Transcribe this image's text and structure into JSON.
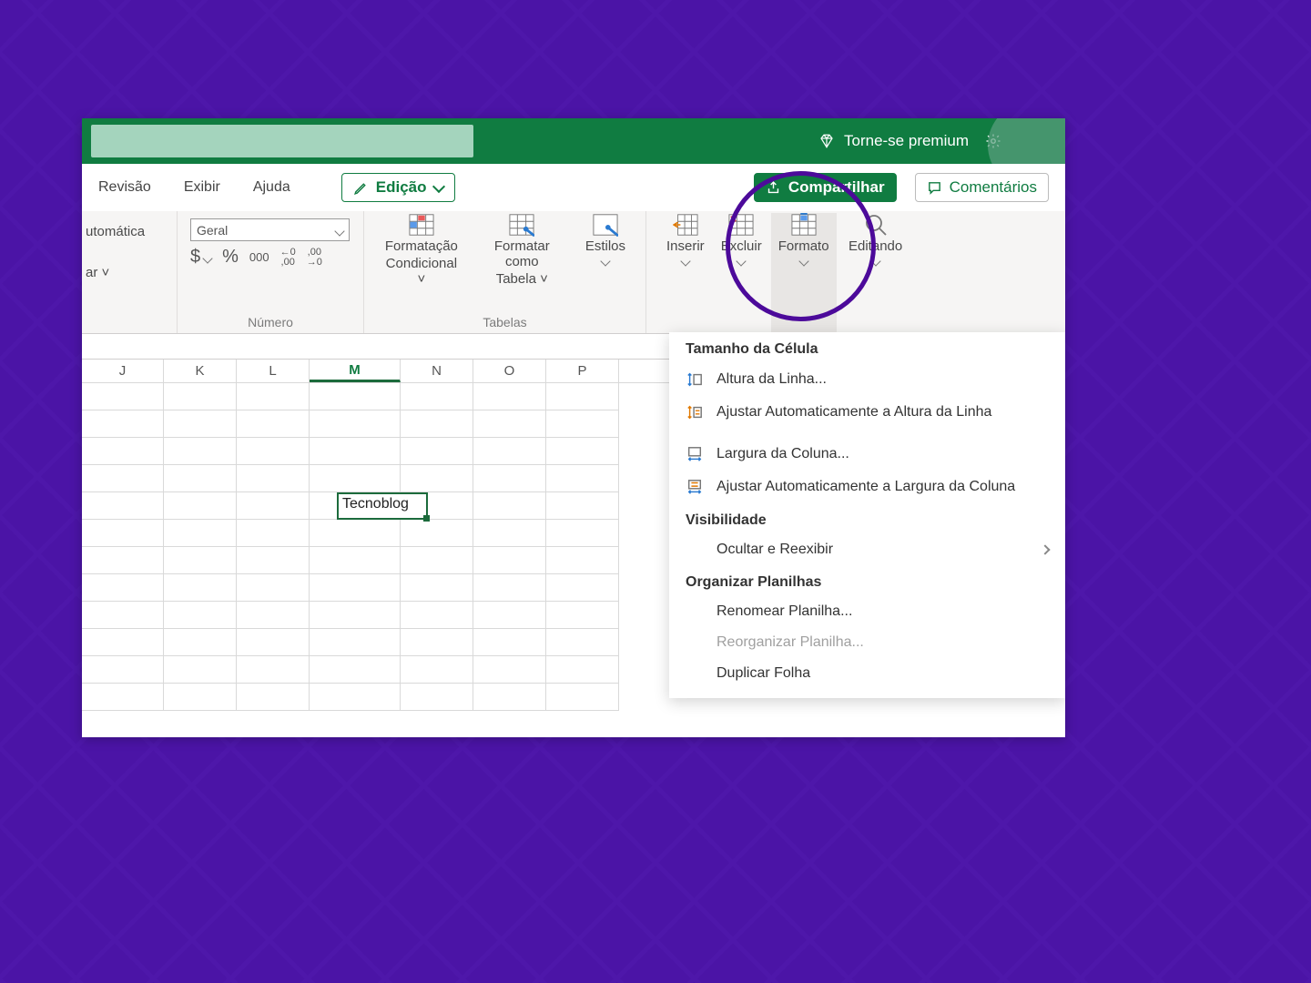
{
  "titlebar": {
    "premium_label": "Torne-se premium"
  },
  "tabs": {
    "revisao": "Revisão",
    "exibir": "Exibir",
    "ajuda": "Ajuda",
    "edicao": "Edição",
    "compartilhar": "Compartilhar",
    "comentarios": "Comentários"
  },
  "ribbon": {
    "left_cut_top": "utomática",
    "left_cut_bottom": "ar ˅",
    "number_format": "Geral",
    "number_group": "Número",
    "cond_line1": "Formatação",
    "cond_line2": "Condicional ˅",
    "table_line1": "Formatar como",
    "table_line2": "Tabela ˅",
    "styles": "Estilos",
    "tables_group": "Tabelas",
    "inserir": "Inserir",
    "excluir": "Excluir",
    "formato": "Formato",
    "editando": "Editando",
    "sym_currency": "$",
    "sym_percent": "%",
    "sym_thousands": "000",
    "sym_dec_inc": "←0\n,00",
    "sym_dec_dec": ",00\n→0"
  },
  "columns": [
    "J",
    "K",
    "L",
    "M",
    "N",
    "O",
    "P"
  ],
  "active_cell_value": "Tecnoblog",
  "menu": {
    "section1": "Tamanho da Célula",
    "row_height": "Altura da Linha...",
    "autofit_row": "Ajustar Automaticamente a Altura da Linha",
    "col_width": "Largura da Coluna...",
    "autofit_col": "Ajustar Automaticamente a Largura da Coluna",
    "section2": "Visibilidade",
    "hide_unhide": "Ocultar e Reexibir",
    "section3": "Organizar Planilhas",
    "rename": "Renomear Planilha...",
    "reorg": "Reorganizar Planilha...",
    "duplicate": "Duplicar Folha"
  }
}
